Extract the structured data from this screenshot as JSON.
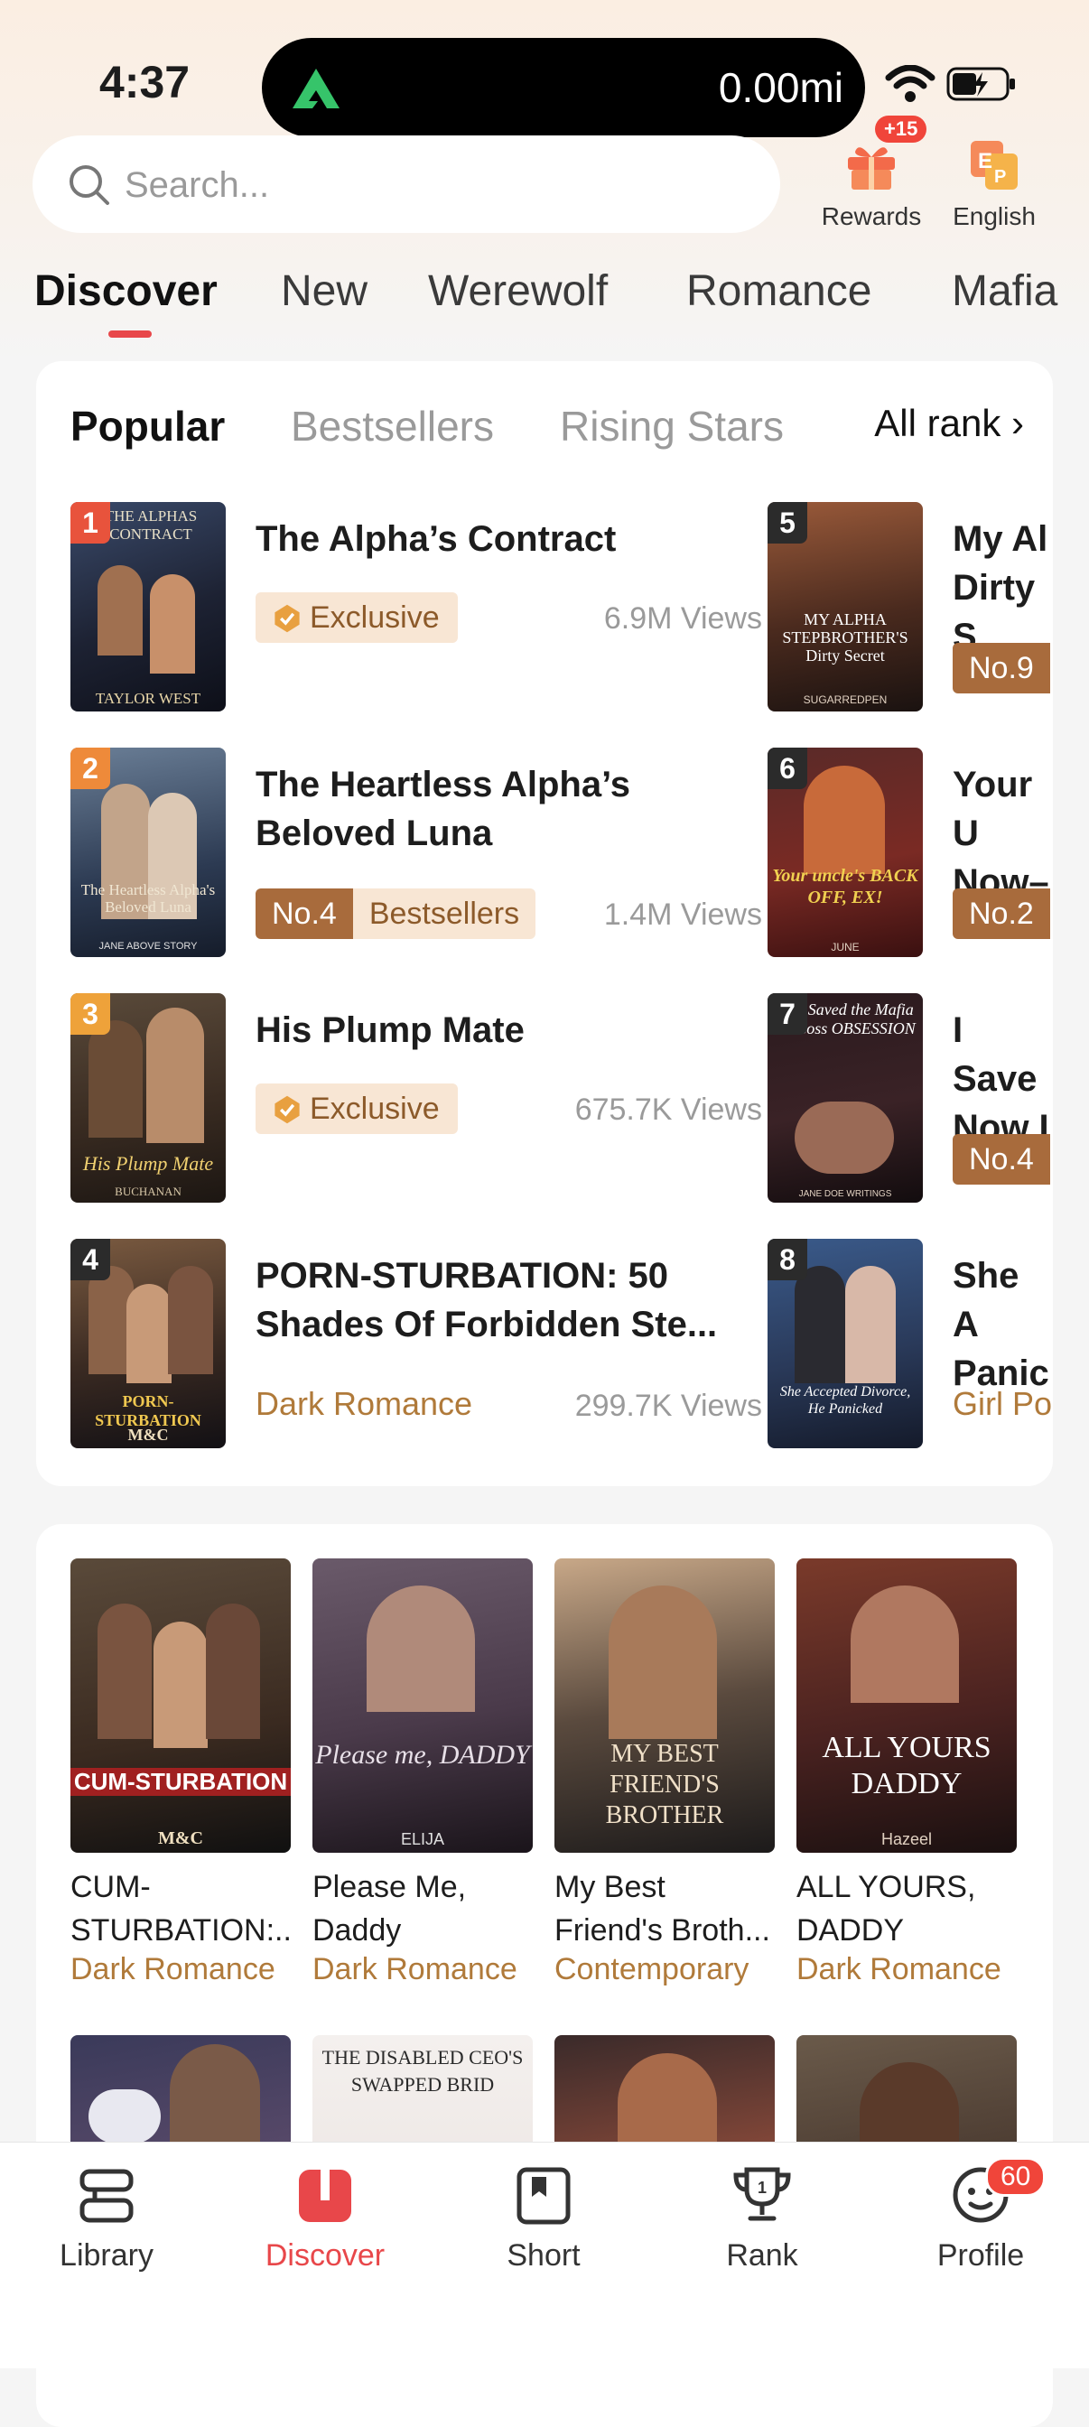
{
  "status_bar": {
    "time": "4:37",
    "activity": "0.00mi"
  },
  "header": {
    "search_placeholder": "Search...",
    "rewards": {
      "label": "Rewards",
      "badge": "+15"
    },
    "language": {
      "label": "English"
    }
  },
  "nav_tabs": [
    {
      "label": "Discover",
      "active": true
    },
    {
      "label": "New"
    },
    {
      "label": "Werewolf"
    },
    {
      "label": "Romance"
    },
    {
      "label": "Mafia"
    }
  ],
  "ranking": {
    "tabs": [
      {
        "label": "Popular",
        "active": true
      },
      {
        "label": "Bestsellers"
      },
      {
        "label": "Rising Stars"
      }
    ],
    "all_rank": "All rank ›",
    "items": [
      {
        "rank": "1",
        "title": "The Alpha’s Contract",
        "tag": "Exclusive",
        "views": "6.9M Views",
        "cover_text": "THE ALPHAS CONTRACT",
        "cover_author": "TAYLOR WEST"
      },
      {
        "rank": "2",
        "title": "The Heartless Alpha’s Beloved Luna",
        "tag_no": "No.4",
        "tag": "Bestsellers",
        "views": "1.4M Views",
        "cover_text": "The Heartless Alpha's Beloved Luna",
        "cover_author": "JANE ABOVE STORY"
      },
      {
        "rank": "3",
        "title": "His Plump Mate",
        "tag": "Exclusive",
        "views": "675.7K Views",
        "cover_text": "His Plump Mate",
        "cover_author": "BUCHANAN"
      },
      {
        "rank": "4",
        "title": "PORN-STURBATION: 50 Shades Of Forbidden Ste...",
        "tag": "Dark Romance",
        "views": "299.7K Views",
        "cover_text": "PORN-STURBATION",
        "cover_author": "M&C"
      }
    ],
    "peek_items": [
      {
        "rank": "5",
        "title": "My Al Dirty S",
        "tag_no": "No.9",
        "cover_text": "MY ALPHA STEPBROTHER'S Dirty Secret",
        "cover_author": "SUGARREDPEN"
      },
      {
        "rank": "6",
        "title": "Your U Now–",
        "tag_no": "No.2",
        "cover_text": "Your uncle's BACK OFF, EX!",
        "cover_author": "JUNE"
      },
      {
        "rank": "7",
        "title": "I Save Now I",
        "tag_no": "No.4",
        "cover_text": "I Saved the Mafia Boss OBSESSION",
        "cover_author": "JANE DOE WRITINGS"
      },
      {
        "rank": "8",
        "title": "She A Panic",
        "tag": "Girl Po",
        "cover_text": "She Accepted Divorce, He Panicked",
        "cover_author": ""
      }
    ]
  },
  "grid": [
    {
      "title": "CUM-STURBATION:...",
      "genre": "Dark Romance",
      "cover_text": "CUM-STURBATION",
      "cover_author": "M&C"
    },
    {
      "title": "Please Me, Daddy",
      "genre": "Dark Romance",
      "cover_text": "Please me, DADDY",
      "cover_author": "ELIJA"
    },
    {
      "title": "My Best Friend's Broth...",
      "genre": "Contemporary",
      "cover_text": "MY BEST FRIEND'S BROTHER",
      "cover_author": ""
    },
    {
      "title": "ALL YOURS, DADDY",
      "genre": "Dark Romance",
      "cover_text": "ALL YOURS DADDY",
      "cover_author": "Hazeel"
    }
  ],
  "grid_row2_covers": [
    {
      "cover_text": ""
    },
    {
      "cover_text": "THE DISABLED CEO'S SWAPPED BRID"
    },
    {
      "cover_text": ""
    },
    {
      "cover_text": ""
    }
  ],
  "bottom_nav": [
    {
      "label": "Library",
      "icon": "library-icon"
    },
    {
      "label": "Discover",
      "icon": "discover-icon",
      "active": true
    },
    {
      "label": "Short",
      "icon": "short-icon"
    },
    {
      "label": "Rank",
      "icon": "trophy-icon"
    },
    {
      "label": "Profile",
      "icon": "profile-icon",
      "badge": "60"
    }
  ],
  "colors": {
    "accent": "#e8474a",
    "gold": "#b07a3a",
    "rank1": "#e8533c",
    "rank2": "#ee8a3a",
    "rank3": "#eea23a",
    "rank_dark": "#2b2b2b"
  }
}
